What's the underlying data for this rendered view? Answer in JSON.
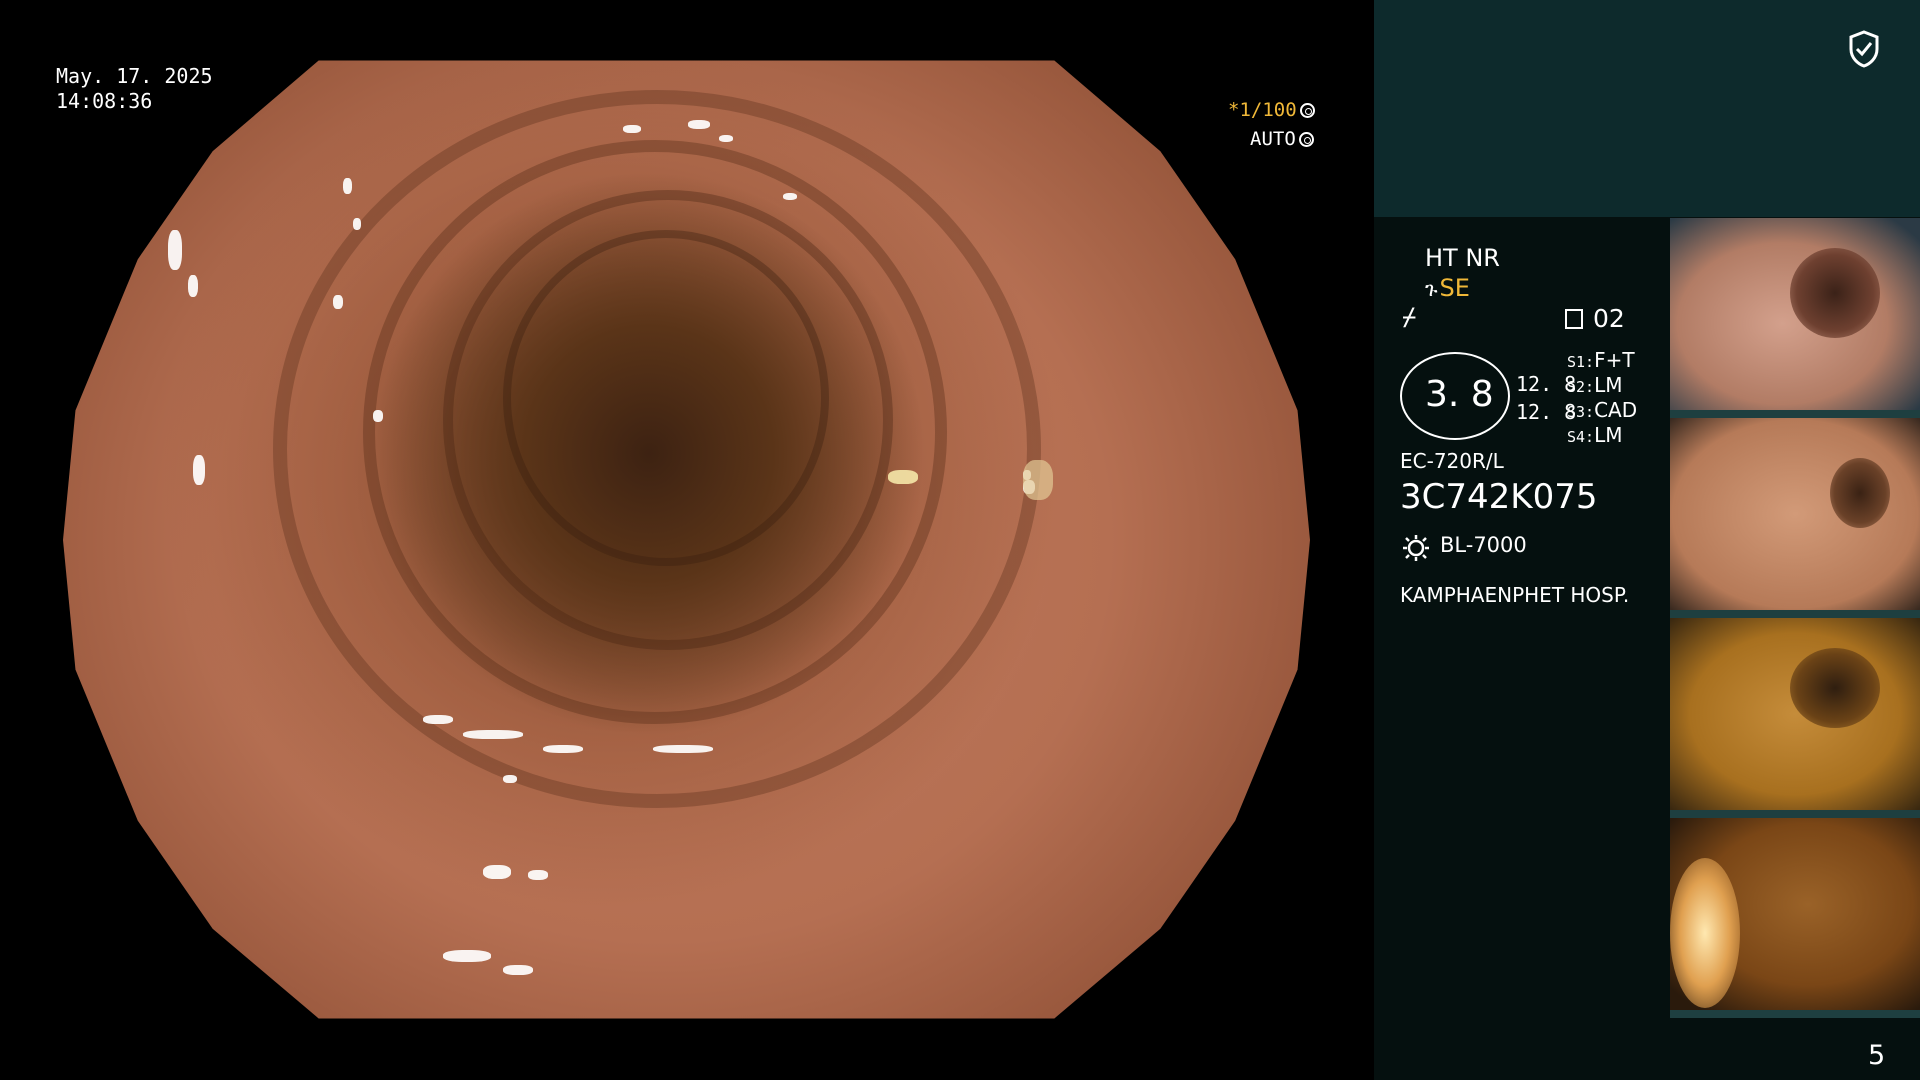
{
  "overlay": {
    "date": "May. 17. 2025",
    "time": "14:08:36",
    "shutter": "*1/100",
    "iris_mode": "AUTO"
  },
  "panel": {
    "mode_line": "HT NR",
    "enhance": "SE",
    "frames": "02",
    "zoom": "3. 8",
    "values": [
      "12. 8",
      "12. 8"
    ],
    "settings": [
      {
        "label": "S1:",
        "value": "F+T"
      },
      {
        "label": "S2:",
        "value": "LM"
      },
      {
        "label": "S3:",
        "value": "CAD"
      },
      {
        "label": "S4:",
        "value": "LM"
      }
    ],
    "model": "EC-720R/L",
    "serial": "3C742K075",
    "light_source": "BL-7000",
    "hospital": "KAMPHAENPHET HOSP.",
    "page_number": "5"
  },
  "colors": {
    "accent": "#f0b838",
    "panel_top": "#0d2a2c",
    "panel": "#05100f"
  },
  "icons": [
    "shield-check-icon",
    "shutter-icon",
    "auto-iris-icon",
    "enhance-icon",
    "frames-icon",
    "light-source-icon"
  ]
}
